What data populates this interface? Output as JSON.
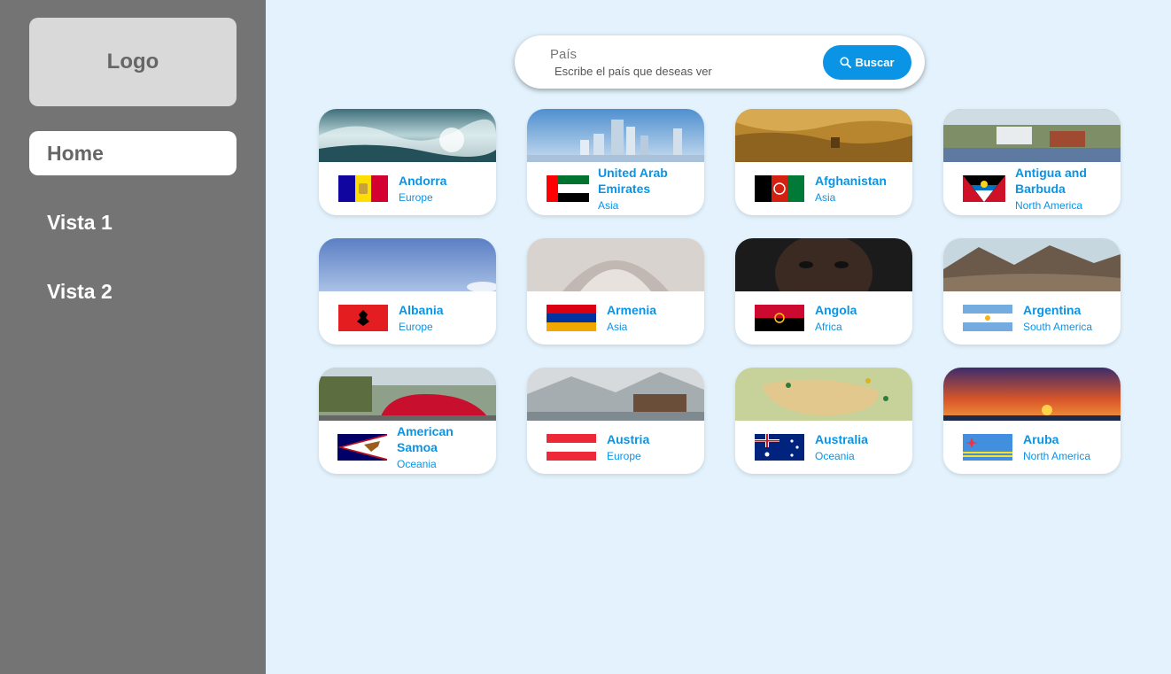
{
  "sidebar": {
    "logo": "Logo",
    "items": [
      {
        "label": "Home",
        "active": true
      },
      {
        "label": "Vista 1",
        "active": false
      },
      {
        "label": "Vista 2",
        "active": false
      }
    ]
  },
  "search": {
    "label": "País",
    "placeholder": "Escribe el país que deseas ver",
    "value": "",
    "button_label": "Buscar",
    "button_icon": "search-icon"
  },
  "colors": {
    "sidebar_bg": "#747474",
    "page_bg": "#e3f2fc",
    "accent": "#0a94e6"
  },
  "countries": [
    {
      "name": "Andorra",
      "region": "Europe",
      "flag": "andorra-flag",
      "photo": "ocean-wave-photo"
    },
    {
      "name": "United Arab Emirates",
      "region": "Asia",
      "flag": "uae-flag",
      "photo": "city-skyline-photo"
    },
    {
      "name": "Afghanistan",
      "region": "Asia",
      "flag": "afghanistan-flag",
      "photo": "rock-cliff-photo"
    },
    {
      "name": "Antigua and Barbuda",
      "region": "North America",
      "flag": "antigua-flag",
      "photo": "harbor-town-photo"
    },
    {
      "name": "Albania",
      "region": "Europe",
      "flag": "albania-flag",
      "photo": "blue-sky-photo"
    },
    {
      "name": "Armenia",
      "region": "Asia",
      "flag": "armenia-flag",
      "photo": "stone-carving-photo"
    },
    {
      "name": "Angola",
      "region": "Africa",
      "flag": "angola-flag",
      "photo": "portrait-photo"
    },
    {
      "name": "Argentina",
      "region": "South America",
      "flag": "argentina-flag",
      "photo": "mountain-photo"
    },
    {
      "name": "American Samoa",
      "region": "Oceania",
      "flag": "american-samoa-flag",
      "photo": "red-car-photo"
    },
    {
      "name": "Austria",
      "region": "Europe",
      "flag": "austria-flag",
      "photo": "alpine-village-photo"
    },
    {
      "name": "Australia",
      "region": "Oceania",
      "flag": "australia-flag",
      "photo": "map-pins-photo"
    },
    {
      "name": "Aruba",
      "region": "North America",
      "flag": "aruba-flag",
      "photo": "sunset-photo"
    }
  ]
}
